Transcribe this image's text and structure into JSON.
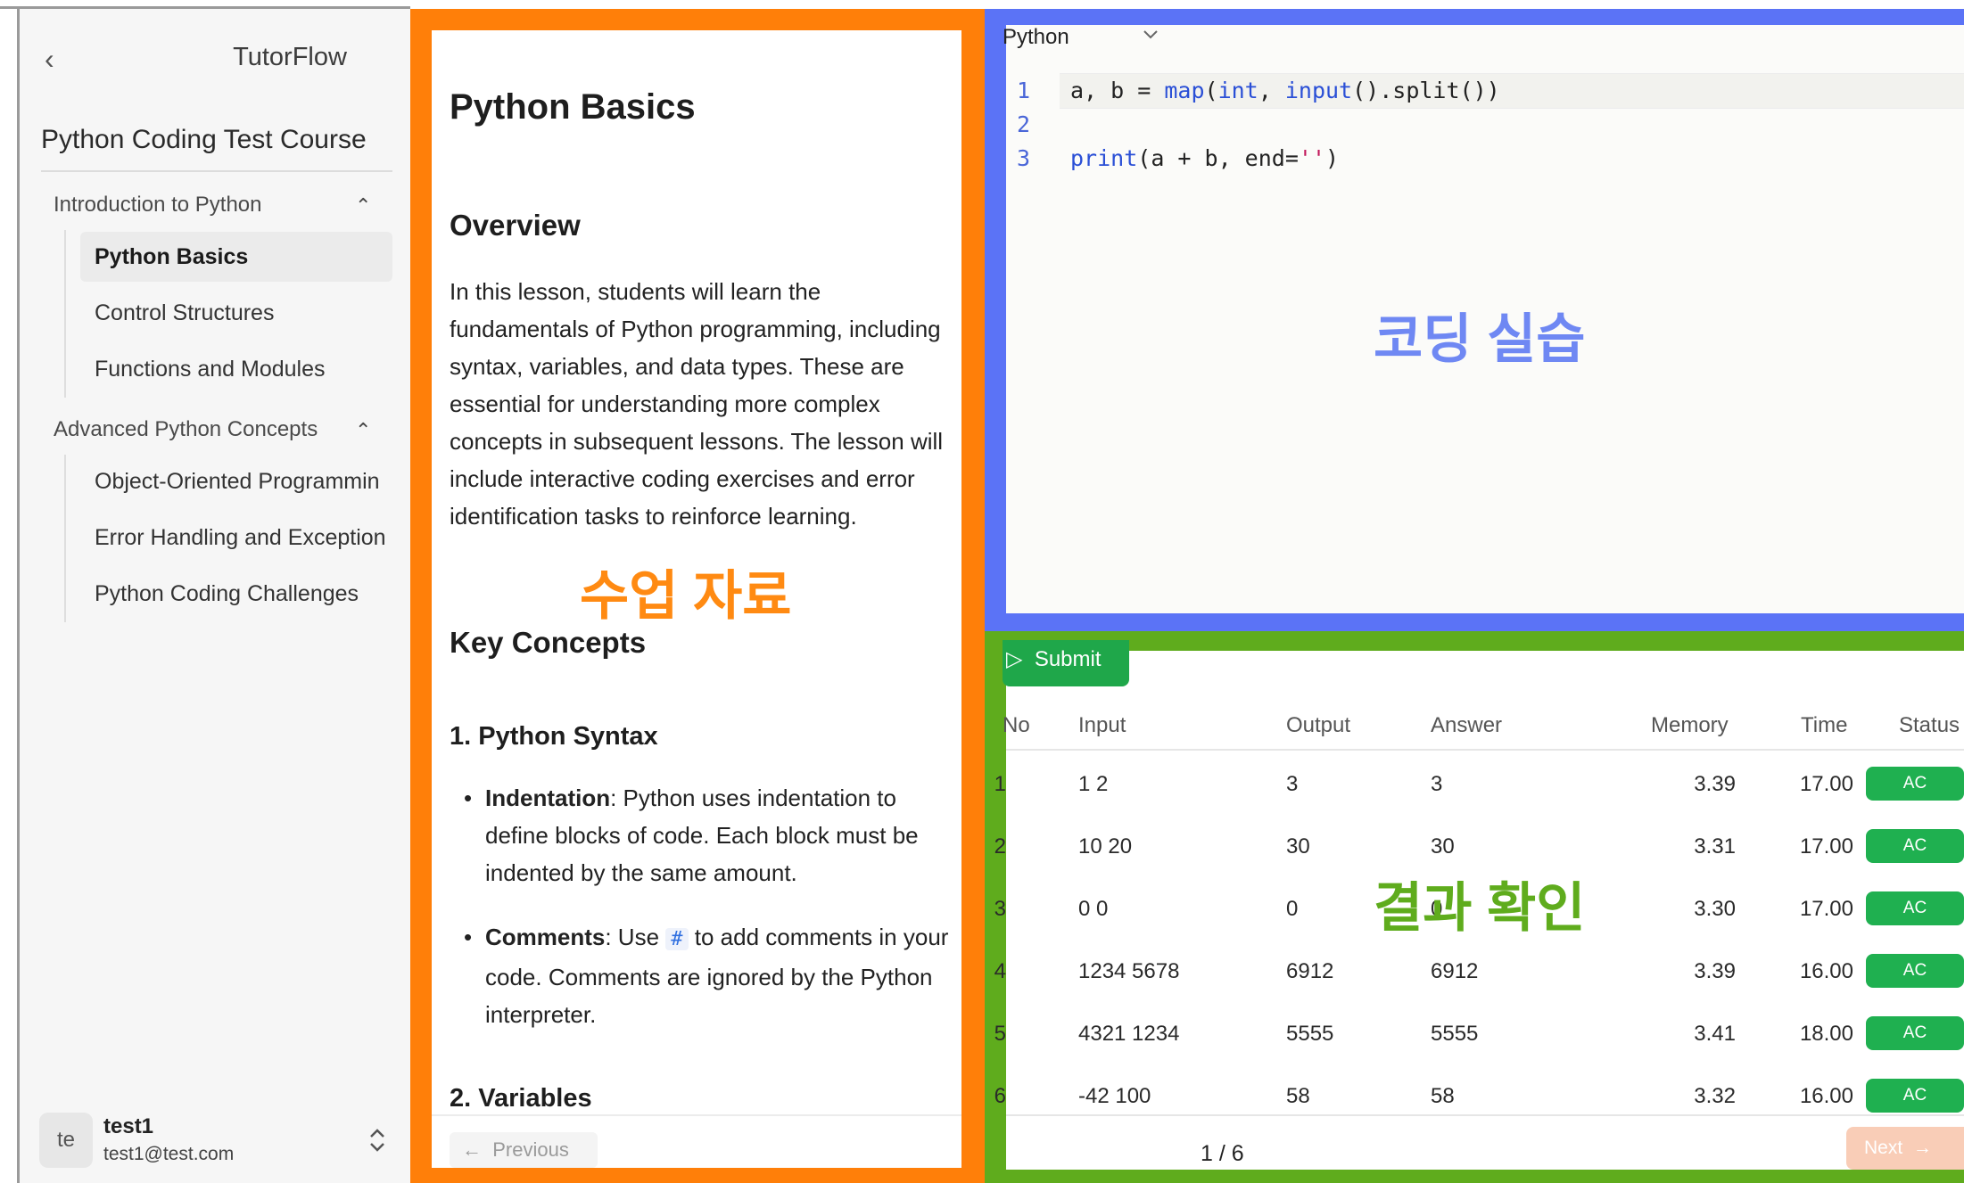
{
  "sidebar": {
    "back_icon": "‹",
    "brand": "TutorFlow",
    "course_title": "Python Coding Test Course",
    "sections": [
      {
        "title": "Introduction to Python",
        "chevron": "⌃",
        "lessons": [
          "Python Basics",
          "Control Structures",
          "Functions and Modules"
        ]
      },
      {
        "title": "Advanced Python Concepts",
        "chevron": "⌃",
        "lessons": [
          "Object-Oriented Programmin",
          "Error Handling and Exception",
          "Python Coding Challenges"
        ]
      }
    ],
    "active_lesson": "Python Basics",
    "user": {
      "avatar": "te",
      "name": "test1",
      "email": "test1@test.com",
      "switch_icon": "⌃⌄"
    }
  },
  "lesson": {
    "title": "Python Basics",
    "overview_heading": "Overview",
    "overview_text": "In this lesson, students will learn the fundamentals of Python programming, including syntax, variables, and data types. These are essential for understanding more complex concepts in subsequent lessons. The lesson will include interactive coding exercises and error identification tasks to reinforce learning.",
    "key_concepts_heading": "Key Concepts",
    "syntax_heading": "1. Python Syntax",
    "bullets": [
      {
        "term": "Indentation",
        "text": ": Python uses indentation to define blocks of code. Each block must be indented by the same amount."
      },
      {
        "term": "Comments",
        "pre": ": Use ",
        "code": "#",
        "post": " to add comments in your code. Comments are ignored by the Python interpreter."
      }
    ],
    "variables_heading": "2. Variables",
    "prev_label": "Previous",
    "overlay_label": "수업 자료"
  },
  "editor": {
    "language": "Python",
    "lines": [
      "a, b = map(int, input().split())",
      "",
      "print(a + b, end='')"
    ],
    "line_numbers": [
      "1",
      "2",
      "3"
    ],
    "overlay_label": "코딩 실습"
  },
  "results": {
    "submit_label": "Submit",
    "columns": [
      "No",
      "Input",
      "Output",
      "Answer",
      "Memory",
      "Time",
      "Status"
    ],
    "rows": [
      {
        "no": "1",
        "input": "1 2",
        "output": "3",
        "answer": "3",
        "memory": "3.39",
        "time": "17.00",
        "status": "AC"
      },
      {
        "no": "2",
        "input": "10 20",
        "output": "30",
        "answer": "30",
        "memory": "3.31",
        "time": "17.00",
        "status": "AC"
      },
      {
        "no": "3",
        "input": "0 0",
        "output": "0",
        "answer": "0",
        "memory": "3.30",
        "time": "17.00",
        "status": "AC"
      },
      {
        "no": "4",
        "input": "1234 5678",
        "output": "6912",
        "answer": "6912",
        "memory": "3.39",
        "time": "16.00",
        "status": "AC"
      },
      {
        "no": "5",
        "input": "4321 1234",
        "output": "5555",
        "answer": "5555",
        "memory": "3.41",
        "time": "18.00",
        "status": "AC"
      },
      {
        "no": "6",
        "input": "-42 100",
        "output": "58",
        "answer": "58",
        "memory": "3.32",
        "time": "16.00",
        "status": "AC"
      }
    ],
    "page_indicator": "1 / 6",
    "next_label": "Next",
    "overlay_label": "결과 확인"
  },
  "colors": {
    "lesson_frame": "#ff7f09",
    "editor_frame": "#5b73f6",
    "results_frame": "#5fac1d",
    "status_ac": "#1fb050"
  }
}
